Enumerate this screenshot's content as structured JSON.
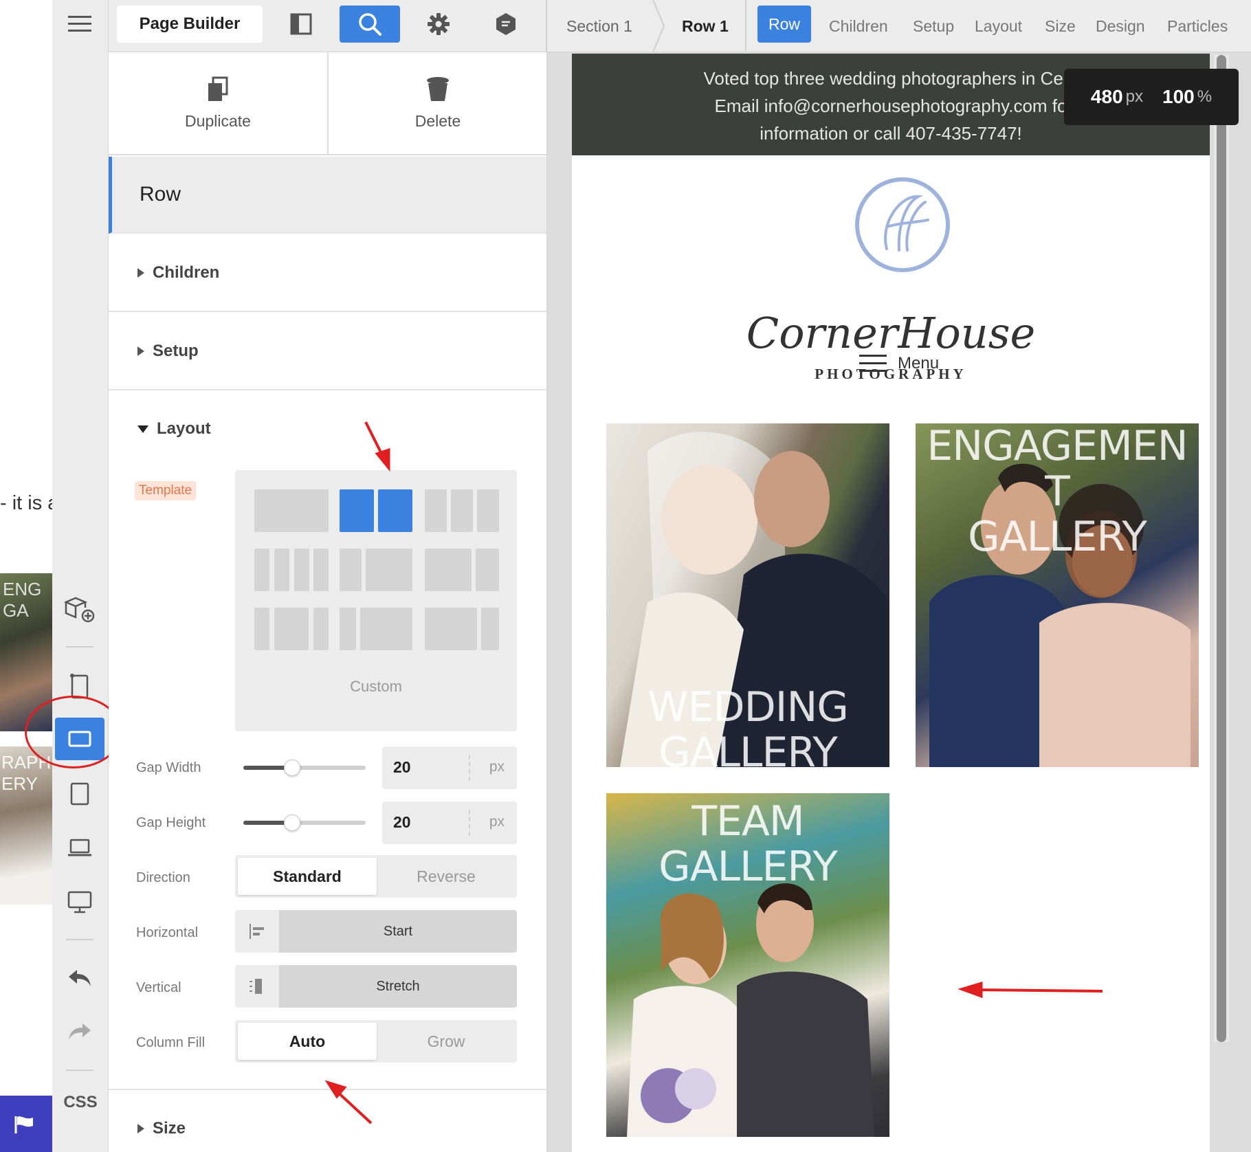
{
  "background": {
    "text_fragment": "- it is a",
    "photo1_caption": "ENG\nGA",
    "photo2_caption": "RAPH\nERY"
  },
  "rail": {
    "css_label": "CSS"
  },
  "toolbar": {
    "title": "Page Builder"
  },
  "breadcrumb": {
    "section": "Section 1",
    "row": "Row 1"
  },
  "tabs": {
    "active": "Row",
    "items": [
      "Children",
      "Setup",
      "Layout",
      "Size",
      "Design",
      "Particles"
    ]
  },
  "panel": {
    "duplicate_label": "Duplicate",
    "delete_label": "Delete",
    "row_title": "Row",
    "children_label": "Children",
    "setup_label": "Setup",
    "layout_label": "Layout",
    "size_label": "Size",
    "template_tag": "Template",
    "template_custom": "Custom",
    "gap_width_label": "Gap Width",
    "gap_width_value": "20",
    "gap_width_fraction": 0.4,
    "gap_height_label": "Gap Height",
    "gap_height_value": "20",
    "gap_height_fraction": 0.4,
    "unit_px": "px",
    "direction_label": "Direction",
    "direction_options": [
      "Standard",
      "Reverse"
    ],
    "horizontal_label": "Horizontal",
    "horizontal_value": "Start",
    "vertical_label": "Vertical",
    "vertical_value": "Stretch",
    "column_fill_label": "Column Fill",
    "column_fill_options": [
      "Auto",
      "Grow"
    ]
  },
  "preview": {
    "announcement_lines": [
      "Voted top three wedding photographers in Cent",
      "Email info@cornerhousephotography.com fo",
      "information or call 407-435-7747!"
    ],
    "logo_script": "CornerHouse",
    "logo_sub": "PHOTOGRAPHY",
    "menu_label": "Menu",
    "galleries": [
      {
        "caption_lines": [
          "WEDDING",
          "GALLERY"
        ]
      },
      {
        "caption_lines": [
          "ENGAGEMEN",
          "T",
          "GALLERY"
        ]
      },
      {
        "caption_lines": [
          "TEAM",
          "GALLERY"
        ]
      }
    ]
  },
  "viewport_badge": {
    "width_value": "480",
    "width_unit": "px",
    "zoom_value": "100",
    "zoom_unit": "%"
  },
  "colors": {
    "accent": "#3b82e0",
    "annotation": "#e02020",
    "template_tag": "#e8754a"
  }
}
